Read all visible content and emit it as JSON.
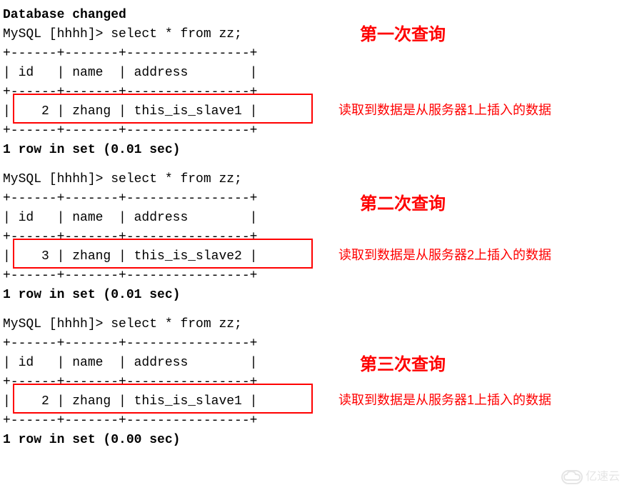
{
  "header": {
    "db_changed": "Database changed"
  },
  "queries": [
    {
      "prompt": "MySQL [hhhh]> select * from zz;",
      "border_top": "+------+-------+----------------+",
      "header_row": "| id   | name  | address        |",
      "border_mid": "+------+-------+----------------+",
      "data_row": "|    2 | zhang | this_is_slave1 |",
      "border_bot": "+------+-------+----------------+",
      "result": "1 row in set (0.01 sec)",
      "title": "第一次查询",
      "note": "读取到数据是从服务器1上插入的数据"
    },
    {
      "prompt": "MySQL [hhhh]> select * from zz;",
      "border_top": "+------+-------+----------------+",
      "header_row": "| id   | name  | address        |",
      "border_mid": "+------+-------+----------------+",
      "data_row": "|    3 | zhang | this_is_slave2 |",
      "border_bot": "+------+-------+----------------+",
      "result": "1 row in set (0.01 sec)",
      "title": "第二次查询",
      "note": "读取到数据是从服务器2上插入的数据"
    },
    {
      "prompt": "MySQL [hhhh]> select * from zz;",
      "border_top": "+------+-------+----------------+",
      "header_row": "| id   | name  | address        |",
      "border_mid": "+------+-------+----------------+",
      "data_row": "|    2 | zhang | this_is_slave1 |",
      "border_bot": "+------+-------+----------------+",
      "result": "1 row in set (0.00 sec)",
      "title": "第三次查询",
      "note": "读取到数据是从服务器1上插入的数据"
    }
  ],
  "watermark": "亿速云"
}
